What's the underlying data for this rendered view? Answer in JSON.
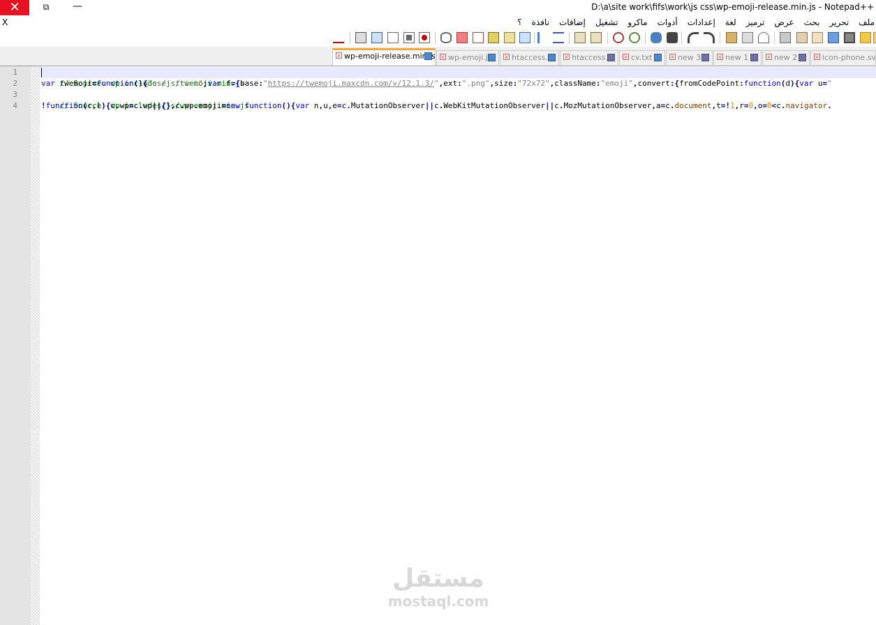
{
  "window": {
    "title": "D:\\a\\site work\\fifs\\work\\js css\\wp-emoji-release.min.js - Notepad++",
    "close_glyph": "✕",
    "restore_glyph": "⧉",
    "minimize_glyph": "—"
  },
  "menubar": {
    "close_doc": "X",
    "items": [
      "ملف",
      "تحرير",
      "بحث",
      "عرض",
      "ترميز",
      "لغة",
      "إعدادات",
      "أدوات",
      "ماكرو",
      "تشغيل",
      "إضافات",
      "نافذة",
      "؟"
    ]
  },
  "toolbar": {
    "icons": [
      "new-file-icon",
      "open-file-icon",
      "save-icon",
      "save-all-icon",
      "close-icon",
      "close-all-icon",
      "print-icon",
      "cut-icon",
      "copy-icon",
      "paste-icon",
      "undo-icon",
      "redo-icon",
      "find-icon",
      "replace-icon",
      "zoom-in-icon",
      "zoom-out-icon",
      "sync-vertical-icon",
      "sync-horizontal-icon",
      "word-wrap-icon",
      "show-all-chars-icon",
      "indent-guide-icon",
      "user-lang-icon",
      "doc-map-icon",
      "function-list-icon",
      "folder-workspace-icon",
      "monitoring-icon",
      "record-macro-icon",
      "stop-record-icon",
      "play-macro-icon",
      "play-multiple-icon",
      "save-macro-icon",
      "spell-check-icon"
    ]
  },
  "tabs": [
    {
      "label": "wp-emoji-release.min.js",
      "active": true
    },
    {
      "label": "wp-emoji.js",
      "active": false
    },
    {
      "label": "htaccess.",
      "active": false
    },
    {
      "label": "htaccess.",
      "active": false
    },
    {
      "label": "cv.txt",
      "active": false
    },
    {
      "label": "new 3",
      "active": false
    },
    {
      "label": "new 1",
      "active": false
    },
    {
      "label": "new 2",
      "active": false
    },
    {
      "label": "icon-phone.svg",
      "active": false
    }
  ],
  "editor": {
    "line_numbers": [
      "1",
      "2",
      "3",
      "4"
    ],
    "lines": [
      "// Source: wp-includes/js/twemoji.min.js",
      "var twemoji=function(){\"use strict\";var f={base:\"https://twemoji.maxcdn.com/v/12.1.3/\",ext:\".png\",size:\"72x72\",className:\"emoji\",convert:{fromCodePoint:function(d){var u=\"",
      "// Source: wp-includes/js/wp-emoji.min.js",
      "!function(c,l){c.wp=c.wp||{},c.wp.emoji=new function(){var n,u,e=c.MutationObserver||c.WebKitMutationObserver||c.MozMutationObserver,a=c.document,t=!1,r=0,o=0<c.navigator."
    ],
    "tokens": {
      "l2_a": "var",
      "l2_b": " twemoji",
      "l2_c": "=",
      "l2_d": "function",
      "l2_e": "(){",
      "l2_f": "\"use strict\"",
      "l2_g": ";",
      "l2_h": "var",
      "l2_i": " f",
      "l2_j": "={",
      "l2_k": "base",
      "l2_l": ":",
      "l2_m": "\"",
      "l2_url": "https://twemoji.maxcdn.com/v/12.1.3/",
      "l2_n": "\"",
      "l2_o": ",",
      "l2_p": "ext",
      "l2_q": ":",
      "l2_r": "\".png\"",
      "l2_s": ",",
      "l2_t": "size",
      "l2_u": ":",
      "l2_v": "\"72x72\"",
      "l2_w": ",",
      "l2_x": "className",
      "l2_y": ":",
      "l2_z": "\"emoji\"",
      "l2_aa": ",",
      "l2_ab": "convert",
      "l2_ac": ":{",
      "l2_ad": "fromCodePoint",
      "l2_ae": ":",
      "l2_af": "function",
      "l2_ag": "(",
      "l2_ah": "d",
      "l2_ai": "){",
      "l2_aj": "var",
      "l2_ak": " u",
      "l2_al": "=",
      "l2_am": "\"",
      "l4_a": "!",
      "l4_b": "function",
      "l4_c": "(",
      "l4_d": "c",
      "l4_e": ",",
      "l4_f": "l",
      "l4_g": "){",
      "l4_h": "c",
      "l4_i": ".",
      "l4_j": "wp",
      "l4_k": "=",
      "l4_l": "c",
      "l4_m": ".",
      "l4_n": "wp",
      "l4_o": "||{},",
      "l4_p": "c",
      "l4_q": ".",
      "l4_r": "wp",
      "l4_s": ".",
      "l4_t": "emoji",
      "l4_u": "=",
      "l4_v": "new",
      "l4_w": " ",
      "l4_x": "function",
      "l4_y": "(){",
      "l4_z": "var",
      "l4_aa": " n",
      "l4_ab": ",",
      "l4_ac": "u",
      "l4_ad": ",",
      "l4_ae": "e",
      "l4_af": "=",
      "l4_ag": "c",
      "l4_ah": ".",
      "l4_ai": "MutationObserver",
      "l4_aj": "||",
      "l4_ak": "c",
      "l4_al": ".",
      "l4_am": "WebKitMutationObserver",
      "l4_an": "||",
      "l4_ao": "c",
      "l4_ap": ".",
      "l4_aq": "MozMutationObserver",
      "l4_ar": ",",
      "l4_as": "a",
      "l4_at": "=",
      "l4_au": "c",
      "l4_av": ".",
      "l4_aw": "document",
      "l4_ax": ",",
      "l4_ay": "t",
      "l4_az": "=!",
      "l4_ba": "1",
      "l4_bb": ",",
      "l4_bc": "r",
      "l4_bd": "=",
      "l4_be": "0",
      "l4_bf": ",",
      "l4_bg": "o",
      "l4_bh": "=",
      "l4_bi": "0",
      "l4_bj": "<",
      "l4_bk": "c",
      "l4_bl": ".",
      "l4_bm": "navigator",
      "l4_bn": "."
    }
  },
  "watermark": {
    "arabic": "مستقل",
    "latin": "mostaql.com"
  },
  "colors": {
    "close_button": "#e81123",
    "active_tab_accent": "#f7a637",
    "comment": "#008000",
    "keyword": "#0000ff",
    "string": "#808080",
    "number": "#ff8000",
    "current_line": "#e8e8ff"
  }
}
